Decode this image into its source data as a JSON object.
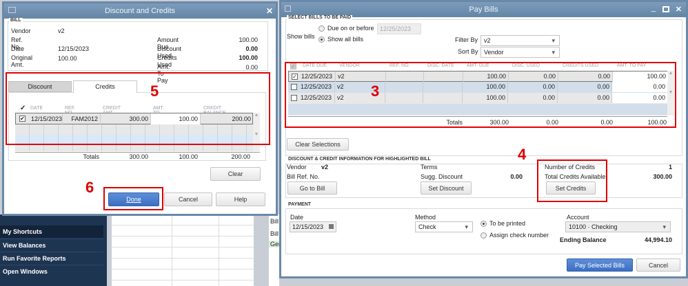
{
  "background": {
    "sidebar": [
      "My Shortcuts",
      "View Balances",
      "Run Favorite Reports",
      "Open Windows"
    ],
    "list_rows": [
      "Bill",
      "Bill",
      "Ger"
    ]
  },
  "dc": {
    "title": "Discount and Credits",
    "bill_section": "BILL",
    "vendor_label": "Vendor",
    "vendor": "v2",
    "ref_label": "Ref. No.",
    "date_label": "Date",
    "date": "12/15/2023",
    "orig_label": "Original Amt.",
    "orig": "100.00",
    "amount_due_label": "Amount Due",
    "amount_due": "100.00",
    "discount_used_label": "Discount Used",
    "discount_used": "0.00",
    "credits_used_label": "Credits Used",
    "credits_used": "100.00",
    "amt_to_pay_label": "Amt. To Pay",
    "amt_to_pay": "0.00",
    "tabs": [
      "Discount",
      "Credits"
    ],
    "headers": [
      "✓",
      "DATE",
      "REF. NO.",
      "CREDIT AMT.",
      "AMT. TO USE",
      "CREDIT BALANCE"
    ],
    "rows": [
      {
        "check": "✔",
        "date": "12/15/2023",
        "ref": "FAM2012",
        "credit_amt": "300.00",
        "amt_to_use": "100.00",
        "balance": "200.00"
      }
    ],
    "totals_label": "Totals",
    "totals": [
      "300.00",
      "100.00",
      "200.00"
    ],
    "clear": "Clear",
    "done": "Done",
    "cancel": "Cancel",
    "help": "Help"
  },
  "pb": {
    "title": "Pay Bills",
    "select_section": "SELECT BILLS TO BE PAID",
    "show_bills": "Show bills",
    "due_on_before": "Due on or before",
    "due_date": "12/25/2023",
    "show_all": "Show all bills",
    "filter_label": "Filter By",
    "filter_value": "v2",
    "sort_label": "Sort By",
    "sort_value": "Vendor",
    "headers": [
      "DATE DUE",
      "VENDOR",
      "REF. NO.",
      "DISC. DATE",
      "AMT. DUE",
      "DISC. USED",
      "CREDITS USED",
      "AMT. TO PAY"
    ],
    "rows": [
      {
        "checked": true,
        "date": "12/25/2023",
        "vendor": "v2",
        "ref": "",
        "disc_date": "",
        "amt_due": "100.00",
        "disc_used": "0.00",
        "credits_used": "0.00",
        "amt_to_pay": "100.00"
      },
      {
        "checked": false,
        "date": "12/25/2023",
        "vendor": "v2",
        "ref": "",
        "disc_date": "",
        "amt_due": "100.00",
        "disc_used": "0.00",
        "credits_used": "0.00",
        "amt_to_pay": "0.00"
      },
      {
        "checked": false,
        "date": "12/25/2023",
        "vendor": "v2",
        "ref": "",
        "disc_date": "",
        "amt_due": "100.00",
        "disc_used": "0.00",
        "credits_used": "0.00",
        "amt_to_pay": "0.00"
      }
    ],
    "totals_label": "Totals",
    "totals": [
      "300.00",
      "0.00",
      "0.00",
      "100.00"
    ],
    "clear_selections": "Clear Selections",
    "dci_section": "DISCOUNT & CREDIT INFORMATION FOR HIGHLIGHTED BILL",
    "vendor_label": "Vendor",
    "vendor": "v2",
    "bill_ref_label": "Bill Ref. No.",
    "go_to_bill": "Go to Bill",
    "terms_label": "Terms",
    "sugg_discount_label": "Sugg. Discount",
    "sugg_discount": "0.00",
    "set_discount": "Set Discount",
    "num_credits_label": "Number of Credits",
    "num_credits": "1",
    "total_credits_label": "Total Credits Available",
    "total_credits": "300.00",
    "set_credits": "Set Credits",
    "payment_section": "PAYMENT",
    "date_label": "Date",
    "pay_date": "12/15/2023",
    "method_label": "Method",
    "method": "Check",
    "to_be_printed": "To be printed",
    "assign_check": "Assign check number",
    "account_label": "Account",
    "account": "10100 · Checking",
    "ending_balance_label": "Ending Balance",
    "ending_balance": "44,994.10",
    "pay_selected": "Pay Selected Bills",
    "cancel": "Cancel"
  },
  "annotations": [
    "5",
    "6",
    "3",
    "4"
  ]
}
